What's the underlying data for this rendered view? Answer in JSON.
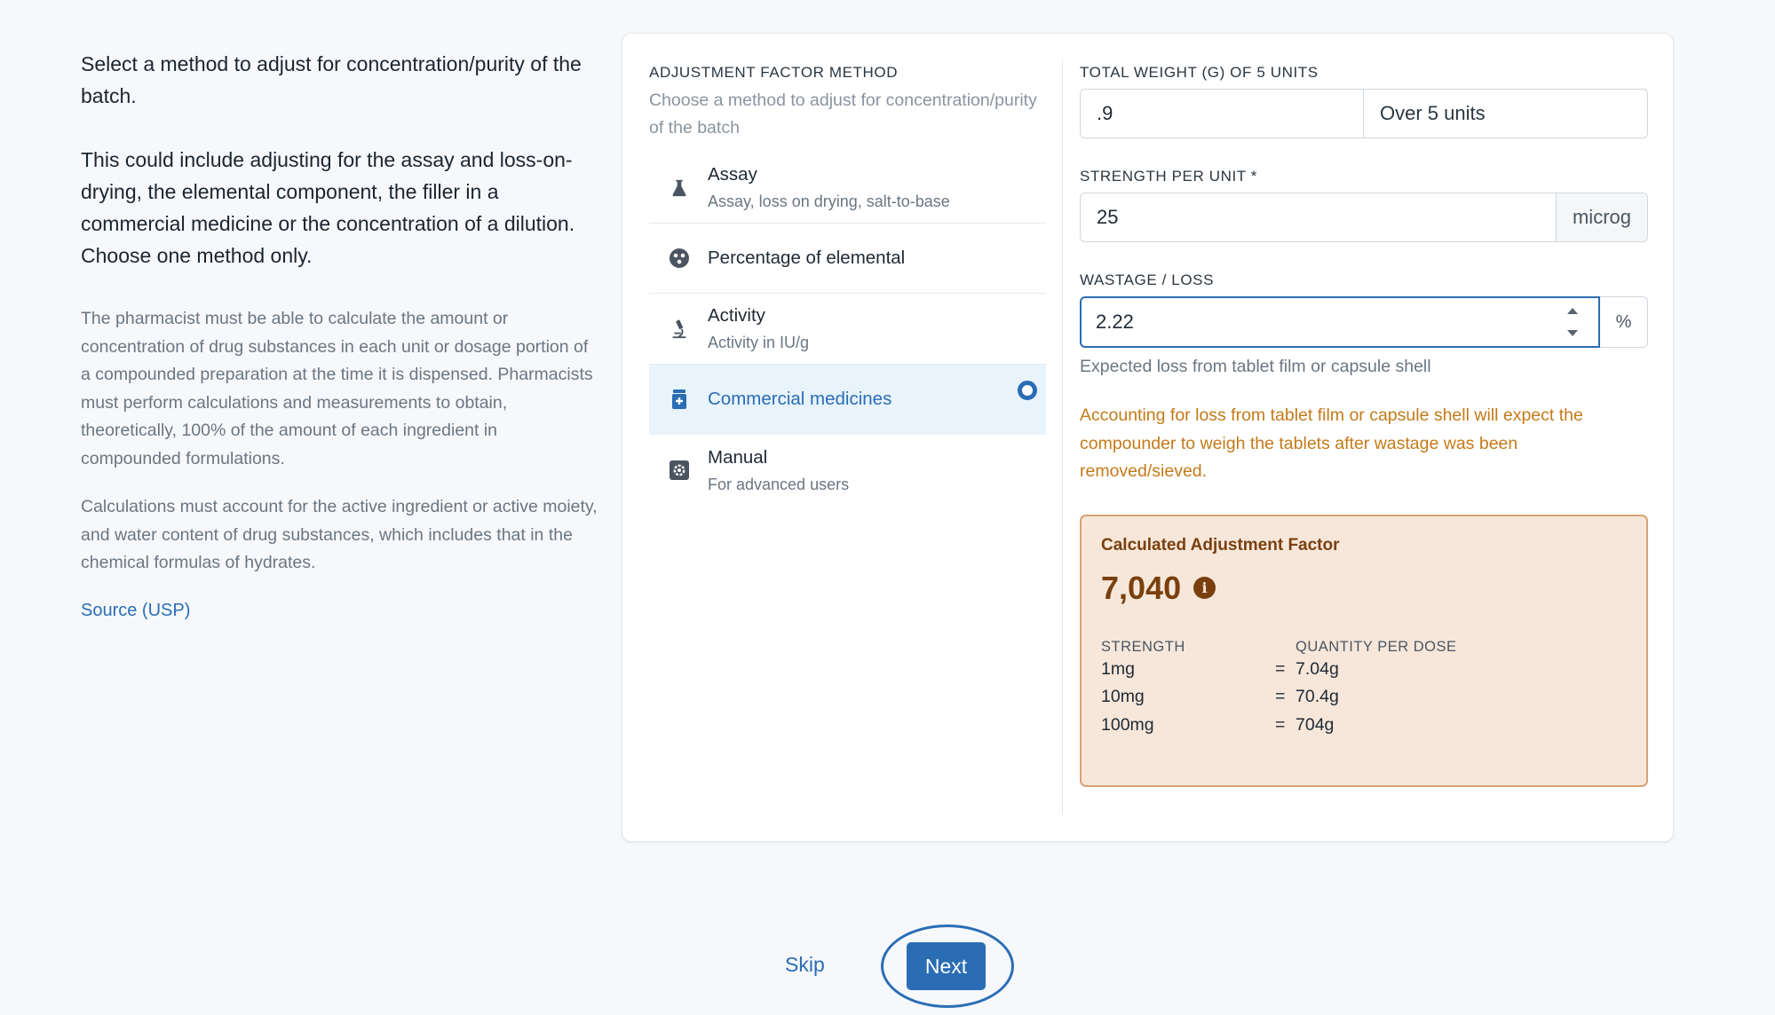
{
  "info": {
    "lead1": "Select a method to adjust for concentration/purity of the batch.",
    "lead2": "This could include adjusting for the assay and loss-on-drying, the elemental component, the filler in a commercial medicine or the concentration of a dilution. Choose one method only.",
    "para1": "The pharmacist must be able to calculate the amount or concentration of drug substances in each unit or dosage portion of a compounded preparation at the time it is dispensed. Pharmacists must perform calculations and measurements to obtain, theoretically, 100% of the amount of each ingredient in compounded formulations.",
    "para2": "Calculations must account for the active ingredient or active moiety, and water content of drug substances, which includes that in the chemical formulas of hydrates.",
    "source_link": "Source (USP)"
  },
  "method_section": {
    "label": "ADJUSTMENT FACTOR METHOD",
    "hint": "Choose a method to adjust for concentration/purity of the batch",
    "selected_color": "#2a6db5",
    "methods": [
      {
        "title": "Assay",
        "subtitle": "Assay, loss on drying, salt-to-base",
        "icon": "flask-icon",
        "selected": false
      },
      {
        "title": "Percentage of elemental",
        "subtitle": "",
        "icon": "atom-icon",
        "selected": false
      },
      {
        "title": "Activity",
        "subtitle": "Activity in IU/g",
        "icon": "microscope-icon",
        "selected": false
      },
      {
        "title": "Commercial medicines",
        "subtitle": "",
        "icon": "medicine-bottle-icon",
        "selected": true
      },
      {
        "title": "Manual",
        "subtitle": "For advanced users",
        "icon": "gear-box-icon",
        "selected": false
      }
    ]
  },
  "fields": {
    "total_weight": {
      "label": "TOTAL WEIGHT (G) OF 5 UNITS",
      "value": ".9",
      "addon": "Over 5 units"
    },
    "strength": {
      "label": "STRENGTH PER UNIT *",
      "value": "25",
      "unit": "microg"
    },
    "wastage": {
      "label": "WASTAGE / LOSS",
      "value": "2.22",
      "unit": "%",
      "help": "Expected loss from tablet film or capsule shell"
    },
    "warning": "Accounting for loss from tablet film or capsule shell will expect the compounder to weigh the tablets after wastage was been removed/sieved."
  },
  "result": {
    "title": "Calculated Adjustment Factor",
    "value": "7,040",
    "info_glyph": "i",
    "col_strength": "STRENGTH",
    "col_quantity": "QUANTITY PER DOSE",
    "equals": "=",
    "rows": [
      {
        "strength": "1mg",
        "quantity": "7.04g"
      },
      {
        "strength": "10mg",
        "quantity": "70.4g"
      },
      {
        "strength": "100mg",
        "quantity": "704g"
      }
    ],
    "accent_color": "#7a3f0e"
  },
  "actions": {
    "skip": "Skip",
    "next": "Next"
  }
}
